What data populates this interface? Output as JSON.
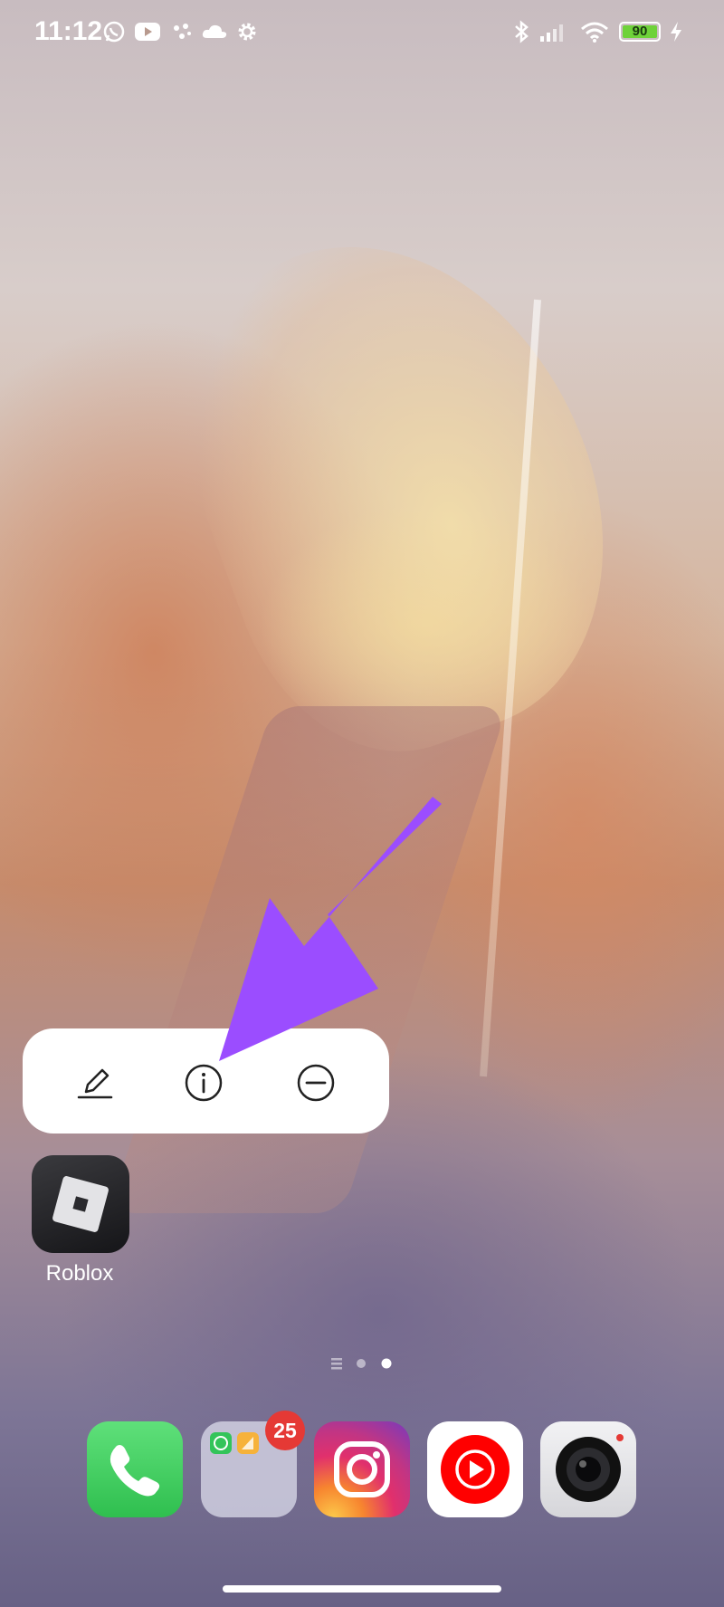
{
  "status_bar": {
    "time": "11:12",
    "left_icons": [
      "whatsapp-icon",
      "youtube-icon",
      "assistant-icon",
      "cloud-icon",
      "settings-icon"
    ],
    "right_icons": [
      "bluetooth-icon",
      "signal-icon",
      "wifi-icon",
      "battery-icon",
      "charging-icon"
    ],
    "battery_percent": "90"
  },
  "context_menu": {
    "actions": [
      {
        "name": "edit",
        "icon": "pencil-icon"
      },
      {
        "name": "app-info",
        "icon": "info-icon"
      },
      {
        "name": "remove",
        "icon": "minus-circle-icon"
      }
    ]
  },
  "annotation": {
    "arrow_color": "#9b4dff"
  },
  "home_apps": [
    {
      "label": "Roblox",
      "icon": "roblox-icon"
    }
  ],
  "page_indicator": {
    "pages": 2,
    "current_page": 2
  },
  "dock": {
    "apps": [
      {
        "name": "Phone",
        "icon": "phone-icon"
      },
      {
        "name": "Folder",
        "icon": "folder-icon",
        "badge": "25"
      },
      {
        "name": "Instagram",
        "icon": "instagram-icon"
      },
      {
        "name": "YouTube Music",
        "icon": "youtube-music-icon"
      },
      {
        "name": "Camera",
        "icon": "camera-icon"
      }
    ]
  }
}
